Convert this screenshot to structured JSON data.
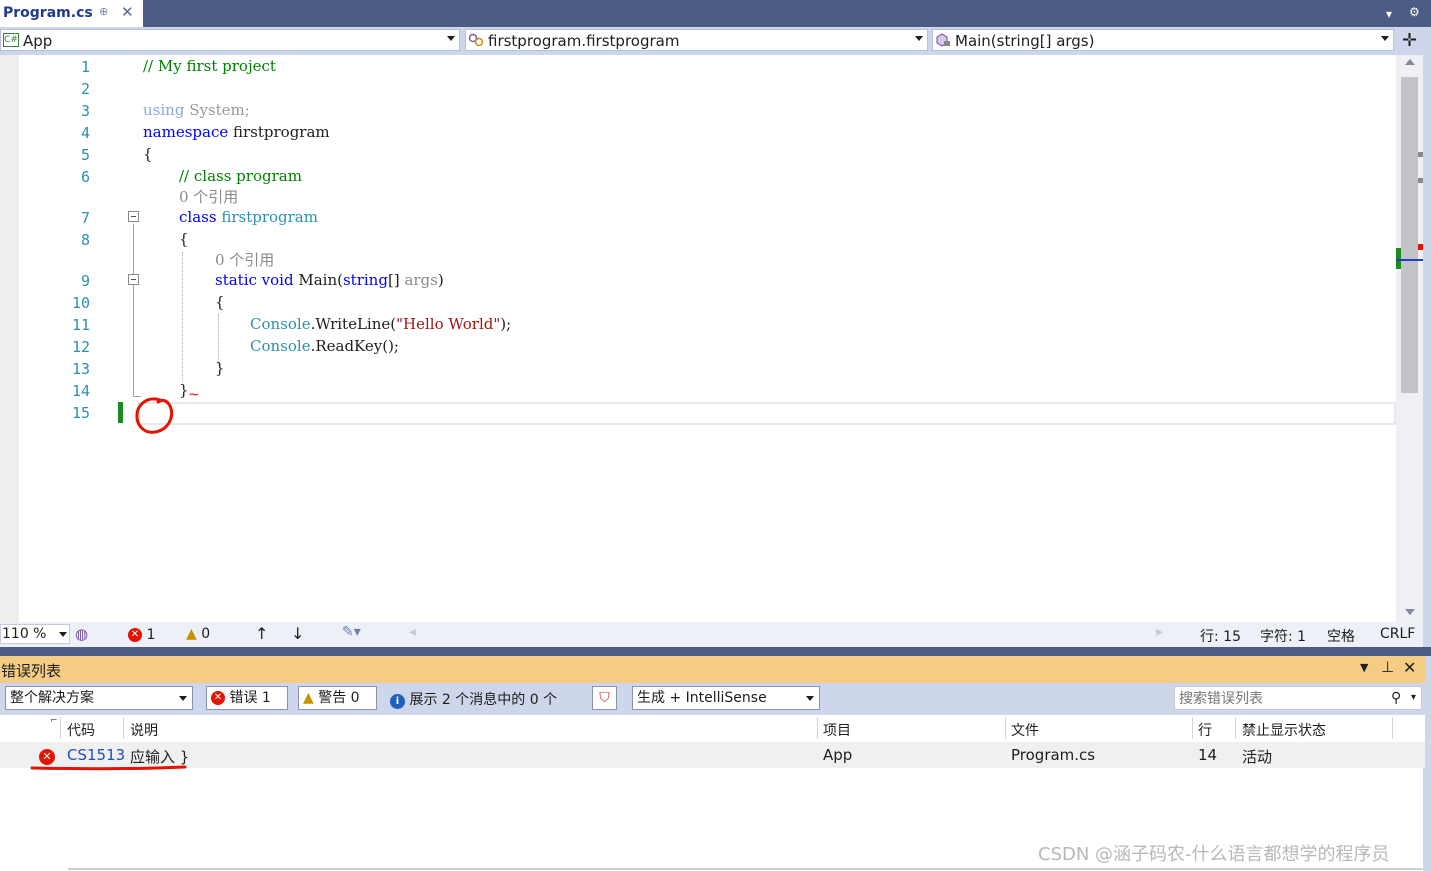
{
  "tab": {
    "title": "Program.cs",
    "pin": "⊕",
    "close": "✕"
  },
  "navbar": {
    "project": "App",
    "project_icon_text": "C#",
    "class_scope": "firstprogram.firstprogram",
    "member_scope": "Main(string[] args)"
  },
  "editor": {
    "line_numbers": [
      "1",
      "2",
      "3",
      "4",
      "5",
      "6",
      "7",
      "8",
      "9",
      "10",
      "11",
      "12",
      "13",
      "14",
      "15"
    ],
    "line1_comment": "// My first project",
    "line3_using": "using",
    "line3_system": " System;",
    "line4_namespace": "namespace",
    "line4_name": " firstprogram",
    "line5": "{",
    "line6_comment": "// class program",
    "refs_class": "0 个引用",
    "line7_class": "class",
    "line7_name": " firstprogram",
    "line8": "{",
    "refs_main": "0 个引用",
    "line9_static": "static",
    "line9_void": " void",
    "line9_main": " Main(",
    "line9_string": "string",
    "line9_brackets": "[] ",
    "line9_args": "args",
    "line9_close": ")",
    "line10": "{",
    "line11_console": "Console",
    "line11_method": ".WriteLine(",
    "line11_str": "\"Hello World\"",
    "line11_end": ");",
    "line12_console": "Console",
    "line12_method": ".ReadKey();",
    "line13": "}",
    "line14": "}",
    "squiggle": "~"
  },
  "statusbar": {
    "zoom": "110 %",
    "errors": "1",
    "warnings": "0",
    "line": "行: 15",
    "char": "字符: 1",
    "space": "空格",
    "eol": "CRLF"
  },
  "errorlist": {
    "title": "错误列表",
    "scope": "整个解决方案",
    "errors_btn": "错误 1",
    "warnings_btn": "警告 0",
    "messages_btn": "展示 2 个消息中的 0 个",
    "build_filter": "生成 + IntelliSense",
    "search_placeholder": "搜索错误列表",
    "columns": [
      "代码",
      "说明",
      "项目",
      "文件",
      "行",
      "禁止显示状态"
    ],
    "rows": [
      {
        "code": "CS1513",
        "description": "应输入 }",
        "project": "App",
        "file": "Program.cs",
        "line": "14",
        "suppression": "活动"
      }
    ]
  },
  "watermark": "CSDN @涵子码农-什么语言都想学的程序员",
  "colors": {
    "chrome": "#4d5c84",
    "navbar": "#cdd6ea",
    "error_header": "#f5cc84",
    "annotation_red": "#e51400"
  }
}
